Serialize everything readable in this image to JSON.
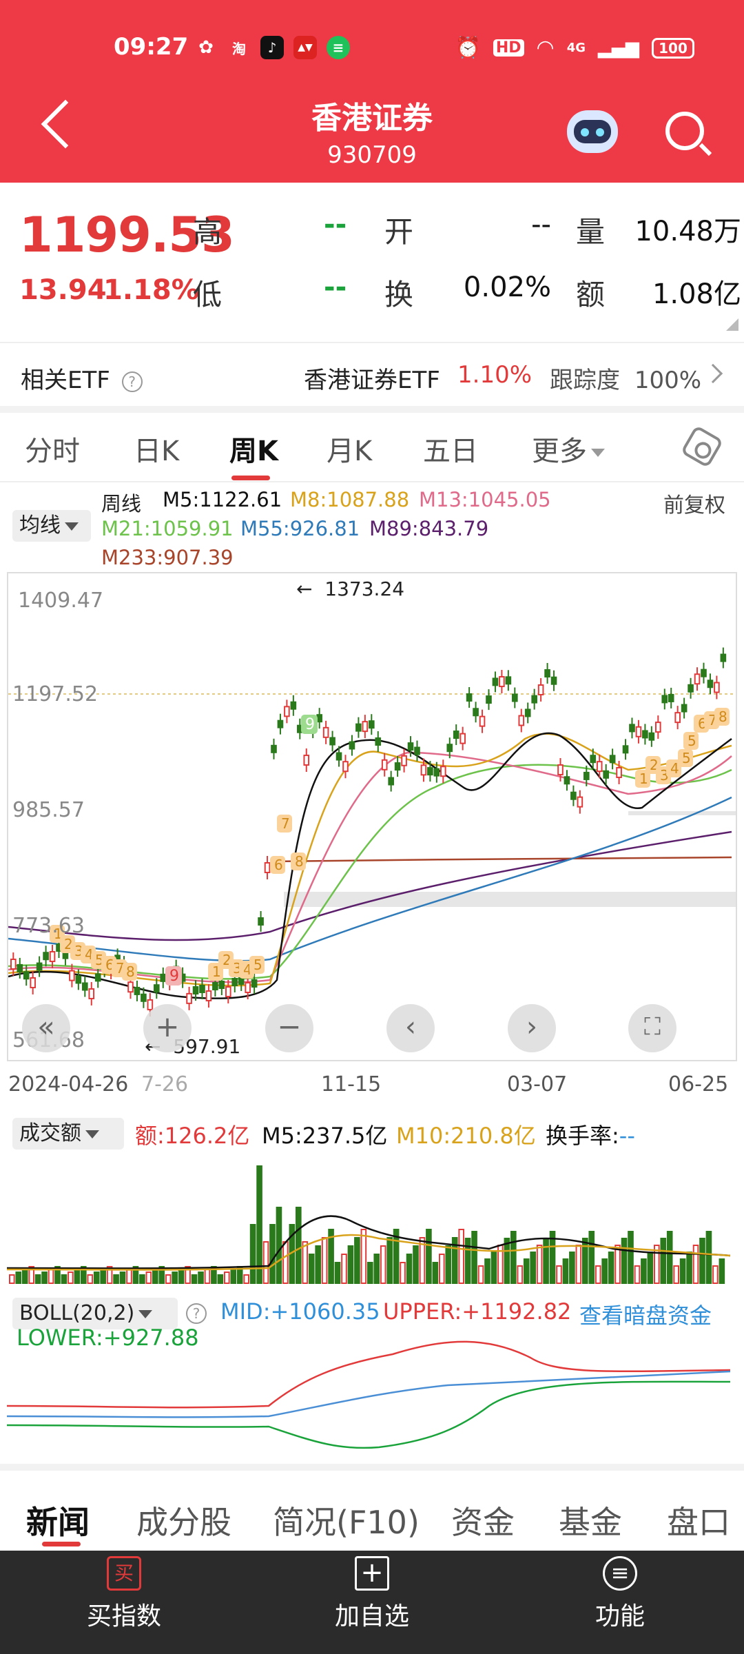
{
  "status": {
    "time": "09:27",
    "network": "4G",
    "battery": "100",
    "hd": "HD"
  },
  "header": {
    "title": "香港证券",
    "code": "930709"
  },
  "quote": {
    "price": "1199.53",
    "change": "13.94",
    "change_pct": "1.18%",
    "high_label": "高",
    "high_value": "--",
    "low_label": "低",
    "low_value": "--",
    "open_label": "开",
    "open_value": "--",
    "turnover_label": "换",
    "turnover_value": "0.02%",
    "volume_label": "量",
    "volume_value": "10.48万",
    "amount_label": "额",
    "amount_value": "1.08亿"
  },
  "etf": {
    "label": "相关ETF",
    "help": "?",
    "name": "香港证券ETF",
    "pct": "1.10%",
    "track_label": "跟踪度",
    "track_value": "100%"
  },
  "tabs": [
    "分时",
    "日K",
    "周K",
    "月K",
    "五日",
    "更多"
  ],
  "ma": {
    "selector": "均线",
    "period": "周线",
    "m5": "M5:1122.61",
    "m8": "M8:1087.88",
    "m13": "M13:1045.05",
    "m21": "M21:1059.91",
    "m55": "M55:926.81",
    "m89": "M89:843.79",
    "m233": "M233:907.39",
    "adjust": "前复权"
  },
  "kline": {
    "y_ticks": [
      "1409.47",
      "1197.52",
      "985.57",
      "773.63",
      "561.68"
    ],
    "max_label": "1373.24",
    "min_label": "597.91",
    "x_ticks": [
      "2024-04-26",
      "7-26",
      "11-15",
      "03-07",
      "06-25"
    ],
    "td_labels_red": [
      "9"
    ],
    "td_labels_green": [
      "9"
    ],
    "td_labels_orange": [
      "1",
      "2",
      "3",
      "4",
      "5",
      "6",
      "7",
      "8",
      "1",
      "2",
      "3",
      "4",
      "5",
      "6",
      "7",
      "8",
      "7",
      "6",
      "8",
      "1",
      "2",
      "3",
      "4",
      "5",
      "6",
      "7",
      "8"
    ]
  },
  "volume": {
    "selector": "成交额",
    "amount": "额:126.2亿",
    "m5": "M5:237.5亿",
    "m10": "M10:210.8亿",
    "turnover": "换手率:",
    "turnover_value": "--"
  },
  "boll": {
    "selector": "BOLL(20,2)",
    "help": "?",
    "mid": "MID:+1060.35",
    "upper": "UPPER:+1192.82",
    "lower": "LOWER:+927.88",
    "link": "查看暗盘资金"
  },
  "bottom_tabs": [
    "新闻",
    "成分股",
    "简况(F10)",
    "资金",
    "基金",
    "盘口"
  ],
  "bottom_bar": {
    "buy_icon": "买",
    "buy_label": "买指数",
    "add_label": "加自选",
    "func_label": "功能"
  },
  "colors": {
    "brand_red": "#ee3a46",
    "up": "#e23a3a",
    "down": "#2a7a1c",
    "m5": "#111111",
    "m8": "#d9a21b",
    "m13": "#e06a8a",
    "m21": "#6cc24a",
    "m55": "#2f7ab8",
    "m89": "#5b1f6b",
    "m233": "#a8442a"
  }
}
